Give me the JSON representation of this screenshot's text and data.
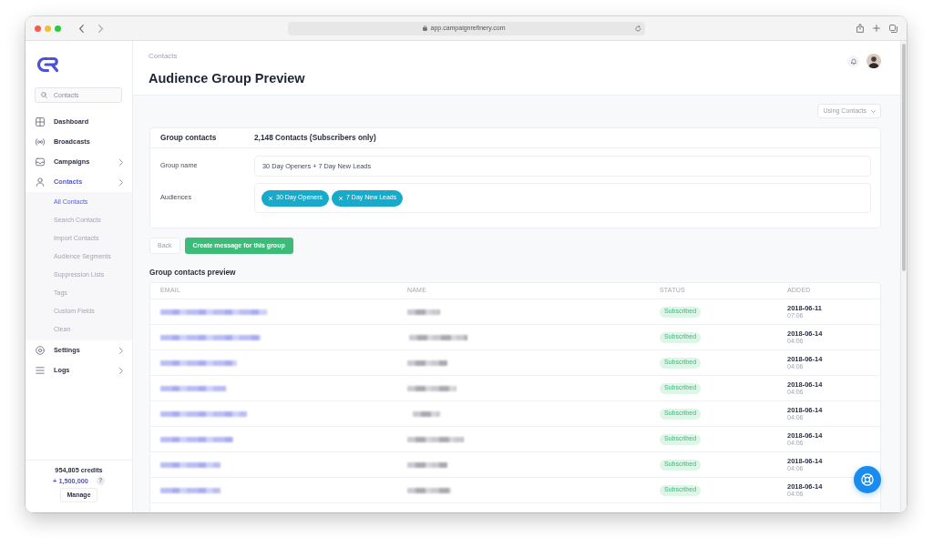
{
  "browser": {
    "url": "app.campaignrefinery.com"
  },
  "sidebar": {
    "search": {
      "placeholder": "Contacts"
    },
    "items": [
      {
        "label": "Dashboard",
        "selected": false,
        "expandable": false
      },
      {
        "label": "Broadcasts",
        "selected": false,
        "expandable": false
      },
      {
        "label": "Campaigns",
        "selected": false,
        "expandable": true
      },
      {
        "label": "Contacts",
        "selected": true,
        "expandable": true,
        "children": [
          {
            "label": "All Contacts",
            "selected": true
          },
          {
            "label": "Search Contacts",
            "selected": false
          },
          {
            "label": "Import Contacts",
            "selected": false
          },
          {
            "label": "Audience Segments",
            "selected": false
          },
          {
            "label": "Suppression Lists",
            "selected": false
          },
          {
            "label": "Tags",
            "selected": false
          },
          {
            "label": "Custom Fields",
            "selected": false
          },
          {
            "label": "Clean",
            "selected": false
          }
        ]
      },
      {
        "label": "Settings",
        "selected": false,
        "expandable": true
      },
      {
        "label": "Logs",
        "selected": false,
        "expandable": true
      }
    ],
    "credits": {
      "balance": "954,805 credits",
      "bonus": "+ 1,500,000",
      "help": "?",
      "button": "Manage"
    }
  },
  "header": {
    "breadcrumb": "Contacts",
    "title": "Audience Group Preview"
  },
  "source_dropdown": {
    "label": "Using Contacts"
  },
  "group_card": {
    "count_label": "Group contacts",
    "count": "2,148 Contacts (Subscribers only)",
    "name_label": "Group name",
    "name_value": "30 Day Openers + 7 Day New Leads",
    "audiences_label": "Audiences",
    "audiences": [
      "30 Day Openers",
      "7 Day New Leads"
    ]
  },
  "actions": [
    {
      "label": "Back",
      "kind": "secondary"
    },
    {
      "label": "Create message for this group",
      "kind": "primary"
    }
  ],
  "preview": {
    "title": "Group contacts preview",
    "columns": [
      "EMAIL",
      "NAME",
      "STATUS",
      "ADDED"
    ],
    "rows": [
      {
        "status": "Subscribed",
        "date": "2018-06-11",
        "time": "07:06"
      },
      {
        "status": "Subscribed",
        "date": "2018-06-14",
        "time": "04:06"
      },
      {
        "status": "Subscribed",
        "date": "2018-06-14",
        "time": "04:06"
      },
      {
        "status": "Subscribed",
        "date": "2018-06-14",
        "time": "04:06"
      },
      {
        "status": "Subscribed",
        "date": "2018-06-14",
        "time": "04:06"
      },
      {
        "status": "Subscribed",
        "date": "2018-06-14",
        "time": "04:06"
      },
      {
        "status": "Subscribed",
        "date": "2018-06-14",
        "time": "04:06"
      },
      {
        "status": "Subscribed",
        "date": "2018-06-14",
        "time": "04:06"
      }
    ]
  }
}
